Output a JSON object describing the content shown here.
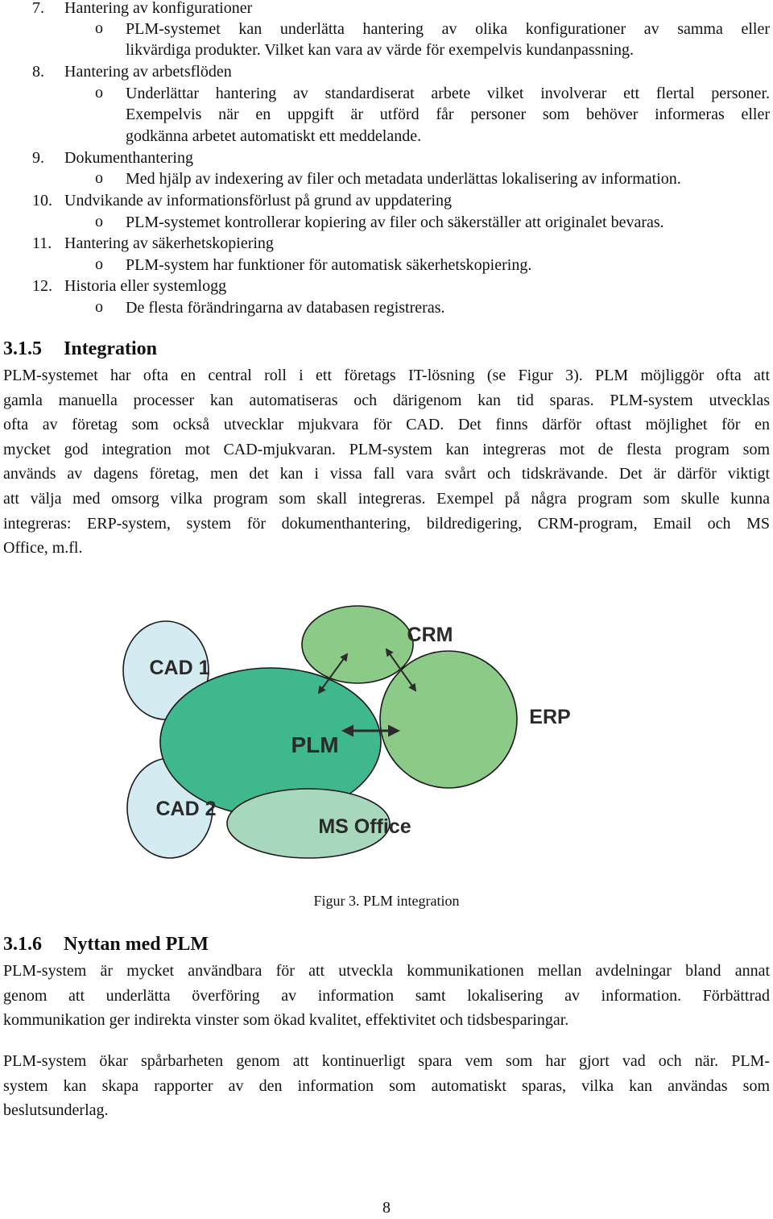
{
  "list_items": [
    {
      "number": "7.",
      "title": "Hantering av konfigurationer",
      "bullet": "o",
      "sub_lines": [
        "PLM-systemet kan underlätta hantering av olika konfigurationer av samma eller",
        "likvärdiga produkter. Vilket kan vara av värde för exempelvis kundanpassning."
      ]
    },
    {
      "number": "8.",
      "title": "Hantering av arbetsflöden",
      "bullet": "o",
      "sub_lines": [
        "Underlättar hantering av standardiserat arbete vilket involverar ett flertal personer.",
        "Exempelvis när en uppgift är utförd får personer som behöver informeras eller",
        "godkänna arbetet automatiskt ett meddelande."
      ]
    },
    {
      "number": "9.",
      "title": "Dokumenthantering",
      "bullet": "o",
      "sub_lines": [
        "Med hjälp av indexering av filer och metadata underlättas lokalisering av information."
      ]
    },
    {
      "number": "10.",
      "title": "Undvikande av informationsförlust på grund av uppdatering",
      "bullet": "o",
      "sub_lines": [
        "PLM-systemet kontrollerar kopiering av filer och säkerställer att originalet bevaras."
      ]
    },
    {
      "number": "11.",
      "title": "Hantering av säkerhetskopiering",
      "bullet": "o",
      "sub_lines": [
        "PLM-system har funktioner för automatisk säkerhetskopiering."
      ]
    },
    {
      "number": "12.",
      "title": "Historia eller systemlogg",
      "bullet": "o",
      "sub_lines": [
        "De flesta förändringarna av databasen registreras."
      ]
    }
  ],
  "section_integration": {
    "number": "3.1.5",
    "title": "Integration",
    "lines": [
      "PLM-systemet har ofta en central roll i ett företags IT-lösning (se Figur 3). PLM möjliggör ofta att",
      "gamla manuella processer kan automatiseras och därigenom kan tid sparas. PLM-system utvecklas",
      "ofta av företag som också utvecklar mjukvara för CAD. Det finns därför oftast möjlighet för en",
      "mycket god integration mot CAD-mjukvaran. PLM-system kan integreras mot de flesta program som",
      "används av dagens företag, men det kan i vissa fall vara svårt och tidskrävande. Det är därför viktigt",
      "att välja med omsorg vilka program som skall integreras. Exempel på några program som skulle kunna",
      "integreras: ERP-system, system för dokumenthantering, bildredigering, CRM-program, Email och MS",
      "Office, m.fl."
    ]
  },
  "figure": {
    "caption": "Figur 3. PLM integration",
    "nodes": [
      {
        "id": "cad1",
        "label": "CAD 1",
        "color": "#d4ebf2"
      },
      {
        "id": "cad2",
        "label": "CAD 2",
        "color": "#d4ebf2"
      },
      {
        "id": "plm",
        "label": "PLM",
        "color": "#40b88e"
      },
      {
        "id": "crm",
        "label": "CRM",
        "color": "#8bcb87"
      },
      {
        "id": "erp",
        "label": "ERP",
        "color": "#8bcb87"
      },
      {
        "id": "msoffice",
        "label": "MS Office",
        "color": "#a8d8bc"
      }
    ],
    "edges": [
      {
        "from": "plm",
        "to": "crm",
        "bidirectional": true
      },
      {
        "from": "crm",
        "to": "erp",
        "bidirectional": true
      },
      {
        "from": "plm",
        "to": "erp",
        "bidirectional": true
      }
    ],
    "outline_color": "#1a1a1a",
    "arrow_color": "#2b2b2b"
  },
  "section_benefits": {
    "number": "3.1.6",
    "title": "Nyttan med PLM",
    "paragraphs": [
      [
        "PLM-system är mycket användbara för att utveckla kommunikationen mellan avdelningar bland annat",
        "genom att underlätta överföring av information samt lokalisering av information. Förbättrad",
        "kommunikation ger indirekta vinster som ökad kvalitet, effektivitet och tidsbesparingar."
      ],
      [
        "PLM-system ökar spårbarheten genom att kontinuerligt spara vem som har gjort vad och när. PLM-",
        "system kan skapa rapporter av den information som automatiskt sparas, vilka kan användas som",
        "beslutsunderlag."
      ]
    ]
  },
  "page_number": "8"
}
